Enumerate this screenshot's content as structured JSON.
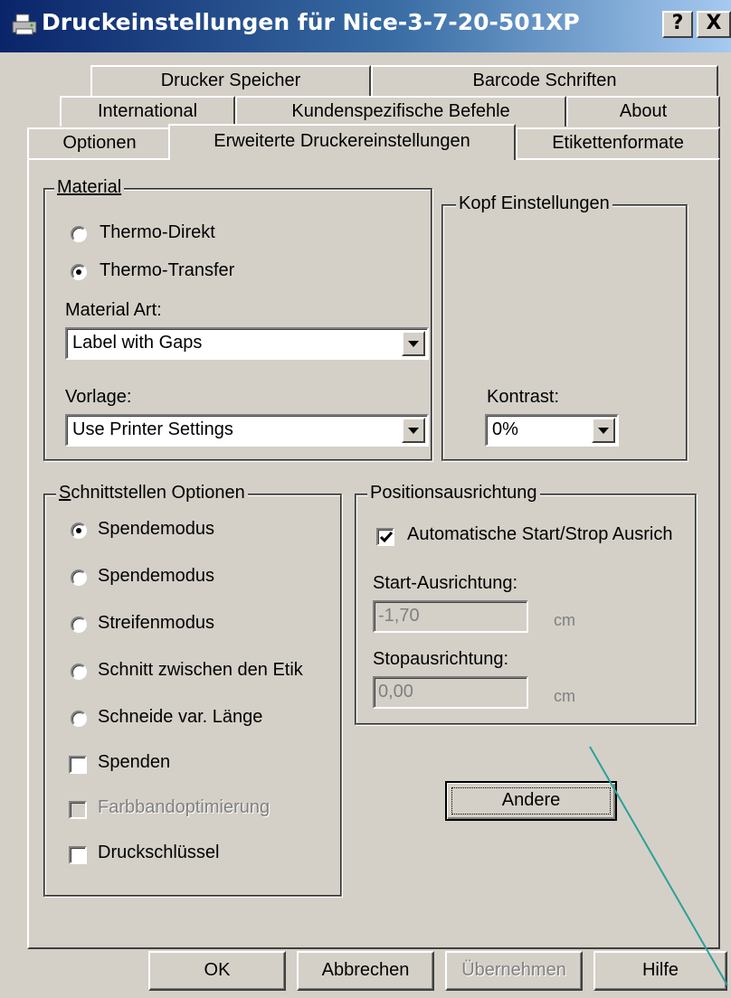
{
  "window": {
    "title": "Druckeinstellungen für Nice-3-7-20-501XP",
    "help_button": "?",
    "close_button": "X"
  },
  "tabs": {
    "row1": [
      "Drucker Speicher",
      "Barcode Schriften"
    ],
    "row2": [
      "International",
      "Kundenspezifische Befehle",
      "About"
    ],
    "row3": [
      "Optionen",
      "Erweiterte Druckereinstellungen",
      "Etikettenformate"
    ],
    "active": "Erweiterte Druckereinstellungen"
  },
  "material": {
    "title": "Material",
    "radio_thermo_direkt": "Thermo-Direkt",
    "radio_thermo_transfer": "Thermo-Transfer",
    "selected": "Thermo-Transfer",
    "material_art_label": "Material Art:",
    "material_art_value": "Label with Gaps",
    "vorlage_label": "Vorlage:",
    "vorlage_value": "Use Printer Settings"
  },
  "kopf": {
    "title": "Kopf Einstellungen",
    "kontrast_label": "Kontrast:",
    "kontrast_value": "0%"
  },
  "schnittstellen": {
    "title": "Schnittstellen Optionen",
    "radio1": "Spendemodus",
    "radio2": "Spendemodus",
    "radio3": "Streifenmodus",
    "radio4": "Schnitt zwischen den Etik",
    "radio5": "Schneide var. Länge",
    "selected_index": 1,
    "check_spenden": "Spenden",
    "check_spenden_checked": false,
    "check_farbband": "Farbbandoptimierung",
    "check_farbband_enabled": false,
    "check_druckschluessel": "Druckschlüssel",
    "check_druckschluessel_checked": false
  },
  "position": {
    "title": "Positionsausrichtung",
    "check_auto": "Automatische Start/Strop Ausrich",
    "check_auto_checked": true,
    "start_label": "Start-Ausrichtung:",
    "start_value": "-1,70",
    "start_unit": "cm",
    "stop_label": "Stopausrichtung:",
    "stop_value": "0,00",
    "stop_unit": "cm"
  },
  "andere_button": "Andere",
  "footer": {
    "ok": "OK",
    "cancel": "Abbrechen",
    "apply": "Übernehmen",
    "help": "Hilfe"
  },
  "colors": {
    "titlebar_start": "#0a246a",
    "titlebar_end": "#a6caf0",
    "dialog_bg": "#d4d0c8",
    "annotation_line": "#2aa198"
  }
}
